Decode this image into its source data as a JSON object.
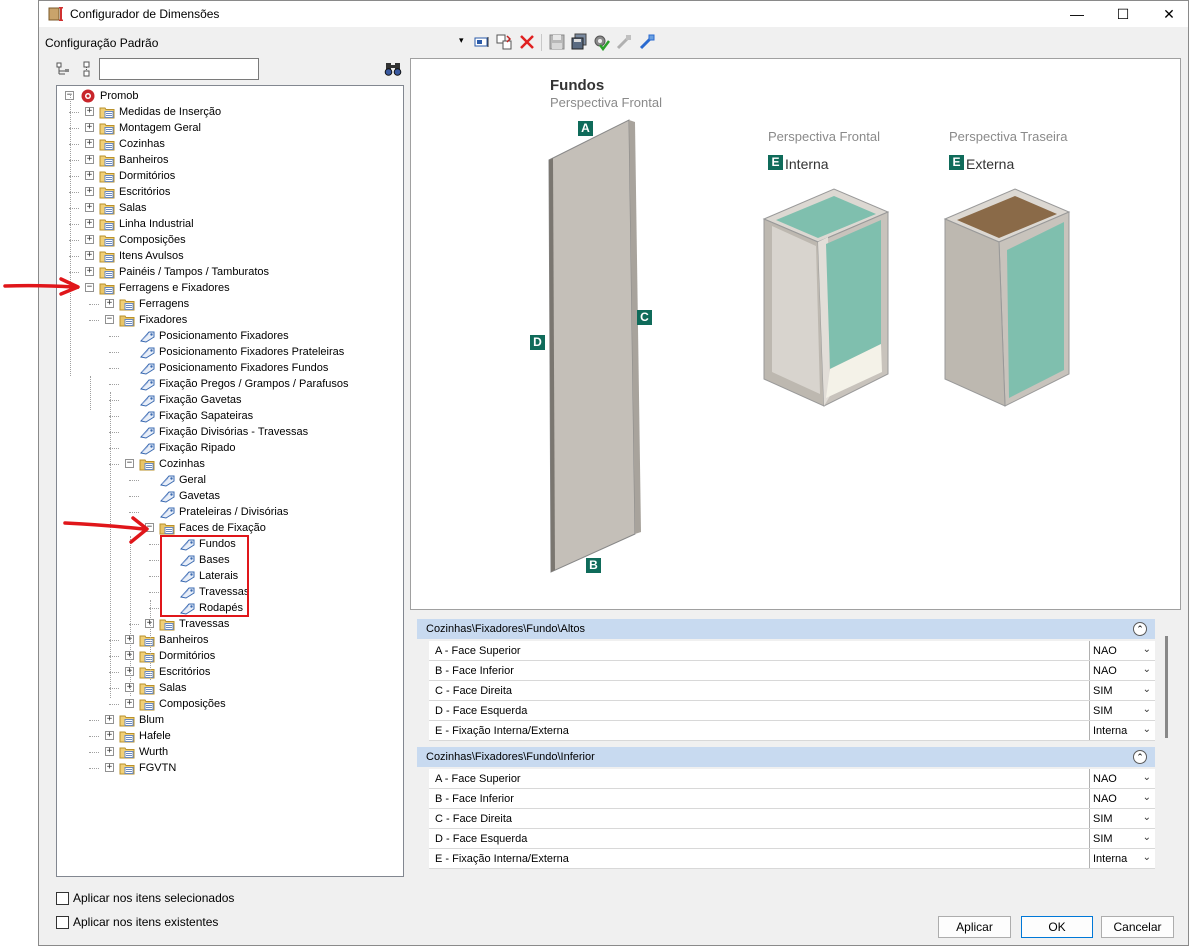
{
  "window": {
    "title": "Configurador de Dimensões",
    "minimize": "—",
    "maximize": "☐",
    "close": "✕"
  },
  "toolbar": {
    "config_label": "Configuração Padrão",
    "dropdown_arrow": "▾"
  },
  "tree": {
    "nodes": [
      {
        "label": "Promob",
        "level": 0,
        "expander": "−",
        "icon": "promob-logo-icon"
      },
      {
        "label": "Medidas de Inserção",
        "level": 1,
        "expander": "+",
        "icon": "folder-icon"
      },
      {
        "label": "Montagem Geral",
        "level": 1,
        "expander": "+",
        "icon": "folder-icon"
      },
      {
        "label": "Cozinhas",
        "level": 1,
        "expander": "+",
        "icon": "folder-icon"
      },
      {
        "label": "Banheiros",
        "level": 1,
        "expander": "+",
        "icon": "folder-icon"
      },
      {
        "label": "Dormitórios",
        "level": 1,
        "expander": "+",
        "icon": "folder-icon"
      },
      {
        "label": "Escritórios",
        "level": 1,
        "expander": "+",
        "icon": "folder-icon"
      },
      {
        "label": "Salas",
        "level": 1,
        "expander": "+",
        "icon": "folder-icon"
      },
      {
        "label": "Linha Industrial",
        "level": 1,
        "expander": "+",
        "icon": "folder-icon"
      },
      {
        "label": "Composições",
        "level": 1,
        "expander": "+",
        "icon": "folder-icon"
      },
      {
        "label": "Itens Avulsos",
        "level": 1,
        "expander": "+",
        "icon": "folder-icon"
      },
      {
        "label": "Painéis / Tampos / Tamburatos",
        "level": 1,
        "expander": "+",
        "icon": "folder-icon"
      },
      {
        "label": "Ferragens e Fixadores",
        "level": 1,
        "expander": "−",
        "icon": "folder-open-icon"
      },
      {
        "label": "Ferragens",
        "level": 2,
        "expander": "+",
        "icon": "folder-icon"
      },
      {
        "label": "Fixadores",
        "level": 2,
        "expander": "−",
        "icon": "folder-open-icon"
      },
      {
        "label": "Posicionamento Fixadores",
        "level": 3,
        "expander": "",
        "icon": "tag-icon"
      },
      {
        "label": "Posicionamento Fixadores Prateleiras",
        "level": 3,
        "expander": "",
        "icon": "tag-icon"
      },
      {
        "label": "Posicionamento Fixadores Fundos",
        "level": 3,
        "expander": "",
        "icon": "tag-icon"
      },
      {
        "label": "Fixação Pregos / Grampos / Parafusos",
        "level": 3,
        "expander": "",
        "icon": "tag-icon"
      },
      {
        "label": "Fixação Gavetas",
        "level": 3,
        "expander": "",
        "icon": "tag-icon"
      },
      {
        "label": "Fixação Sapateiras",
        "level": 3,
        "expander": "",
        "icon": "tag-icon"
      },
      {
        "label": "Fixação Divisórias - Travessas",
        "level": 3,
        "expander": "",
        "icon": "tag-icon"
      },
      {
        "label": "Fixação Ripado",
        "level": 3,
        "expander": "",
        "icon": "tag-icon"
      },
      {
        "label": "Cozinhas",
        "level": 3,
        "expander": "−",
        "icon": "folder-open-icon"
      },
      {
        "label": "Geral",
        "level": 4,
        "expander": "",
        "icon": "tag-icon"
      },
      {
        "label": "Gavetas",
        "level": 4,
        "expander": "",
        "icon": "tag-icon"
      },
      {
        "label": "Prateleiras / Divisórias",
        "level": 4,
        "expander": "",
        "icon": "tag-icon"
      },
      {
        "label": "Faces de Fixação",
        "level": 4,
        "expander": "−",
        "icon": "folder-open-icon"
      },
      {
        "label": "Fundos",
        "level": 5,
        "expander": "",
        "icon": "tag-icon"
      },
      {
        "label": "Bases",
        "level": 5,
        "expander": "",
        "icon": "tag-icon"
      },
      {
        "label": "Laterais",
        "level": 5,
        "expander": "",
        "icon": "tag-icon"
      },
      {
        "label": "Travessas",
        "level": 5,
        "expander": "",
        "icon": "tag-icon"
      },
      {
        "label": "Rodapés",
        "level": 5,
        "expander": "",
        "icon": "tag-icon"
      },
      {
        "label": "Travessas",
        "level": 4,
        "expander": "+",
        "icon": "folder-icon"
      },
      {
        "label": "Banheiros",
        "level": 3,
        "expander": "+",
        "icon": "folder-icon"
      },
      {
        "label": "Dormitórios",
        "level": 3,
        "expander": "+",
        "icon": "folder-icon"
      },
      {
        "label": "Escritórios",
        "level": 3,
        "expander": "+",
        "icon": "folder-icon"
      },
      {
        "label": "Salas",
        "level": 3,
        "expander": "+",
        "icon": "folder-icon"
      },
      {
        "label": "Composições",
        "level": 3,
        "expander": "+",
        "icon": "folder-icon"
      },
      {
        "label": "Blum",
        "level": 2,
        "expander": "+",
        "icon": "folder-icon"
      },
      {
        "label": "Hafele",
        "level": 2,
        "expander": "+",
        "icon": "folder-icon"
      },
      {
        "label": "Wurth",
        "level": 2,
        "expander": "+",
        "icon": "folder-icon"
      },
      {
        "label": "FGVTN",
        "level": 2,
        "expander": "+",
        "icon": "folder-icon"
      }
    ]
  },
  "preview": {
    "title": "Fundos",
    "subtitle": "Perspectiva Frontal",
    "label_a": "A",
    "label_b": "B",
    "label_c": "C",
    "label_d": "D",
    "label_e": "E",
    "front_caption": "Perspectiva Frontal",
    "back_caption": "Perspectiva Traseira",
    "internal_label": "Interna",
    "external_label": "Externa"
  },
  "groups": [
    {
      "title": "Cozinhas\\Fixadores\\Fundo\\Altos",
      "rows": [
        {
          "name": "A - Face Superior",
          "value": "NAO"
        },
        {
          "name": "B - Face Inferior",
          "value": "NAO"
        },
        {
          "name": "C - Face Direita",
          "value": "SIM"
        },
        {
          "name": "D - Face Esquerda",
          "value": "SIM"
        },
        {
          "name": "E - Fixação Interna/Externa",
          "value": "Interna"
        }
      ]
    },
    {
      "title": "Cozinhas\\Fixadores\\Fundo\\Inferior",
      "rows": [
        {
          "name": "A - Face Superior",
          "value": "NAO"
        },
        {
          "name": "B - Face Inferior",
          "value": "NAO"
        },
        {
          "name": "C - Face Direita",
          "value": "SIM"
        },
        {
          "name": "D - Face Esquerda",
          "value": "SIM"
        },
        {
          "name": "E - Fixação Interna/Externa",
          "value": "Interna"
        }
      ]
    }
  ],
  "options": {
    "apply_selected": "Aplicar nos itens selecionados",
    "apply_existing": "Aplicar nos itens existentes"
  },
  "buttons": {
    "apply": "Aplicar",
    "ok": "OK",
    "cancel": "Cancelar"
  },
  "colors": {
    "accent_green": "#0f6b5a",
    "group_header": "#c8daf0",
    "annotation_red": "#e0161a"
  }
}
